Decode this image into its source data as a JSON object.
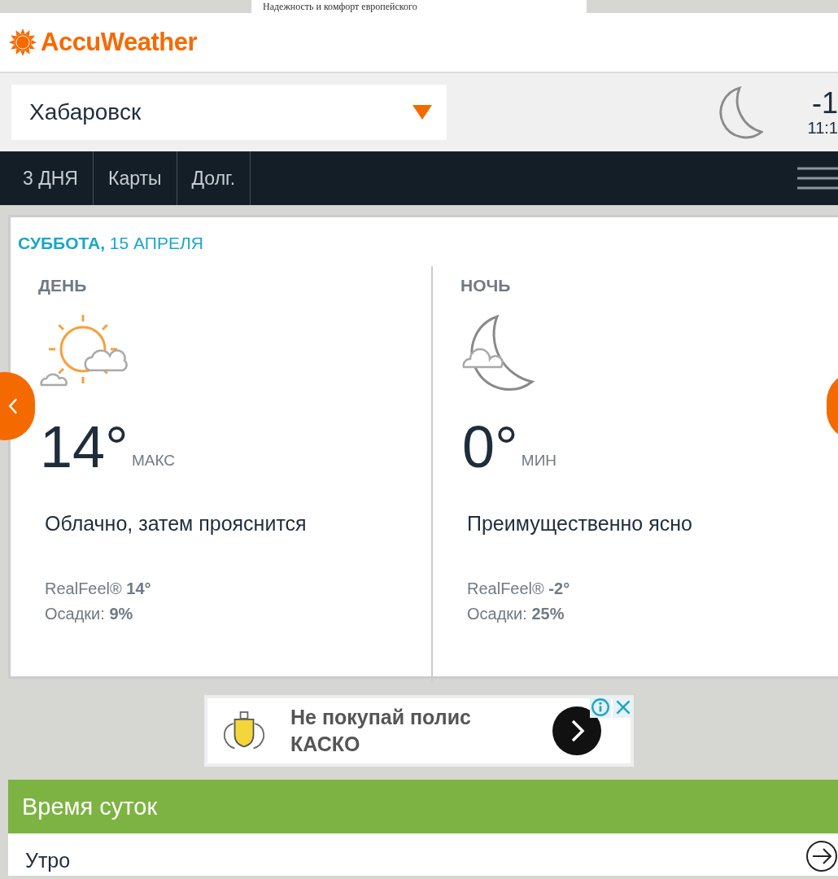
{
  "top_banner": {
    "text": "Надежность и комфорт европейского"
  },
  "header": {
    "logo": "AccuWeather"
  },
  "location": {
    "city": "Хабаровск",
    "current_temp": "-1",
    "current_time": "11:1"
  },
  "nav": {
    "tabs": [
      {
        "label": "3 ДНЯ",
        "selected": false
      },
      {
        "label": "Карты",
        "selected": false
      },
      {
        "label": "Долг.",
        "selected": false
      }
    ]
  },
  "forecast": {
    "date_day": "СУББОТА,",
    "date": "15 АПРЕЛЯ",
    "panels": [
      {
        "kind": "day",
        "heading": "ДЕНЬ",
        "temp": "14°",
        "temp_label": "МАКС",
        "phrase": "Облачно, затем прояснится",
        "realfeel_label": "RealFeel®",
        "realfeel": "14°",
        "precip_label": "Осадки:",
        "precip": "9%"
      },
      {
        "kind": "night",
        "heading": "НОЧЬ",
        "temp": "0°",
        "temp_label": "МИН",
        "phrase": "Преимущественно ясно",
        "realfeel_label": "RealFeel®",
        "realfeel": "-2°",
        "precip_label": "Осадки:",
        "precip": "25%"
      }
    ]
  },
  "ad": {
    "line_1": "Не покупай полис",
    "line_2": "КАСКО"
  },
  "time_of_day": {
    "title": "Время суток",
    "rows": [
      "Утро"
    ]
  }
}
